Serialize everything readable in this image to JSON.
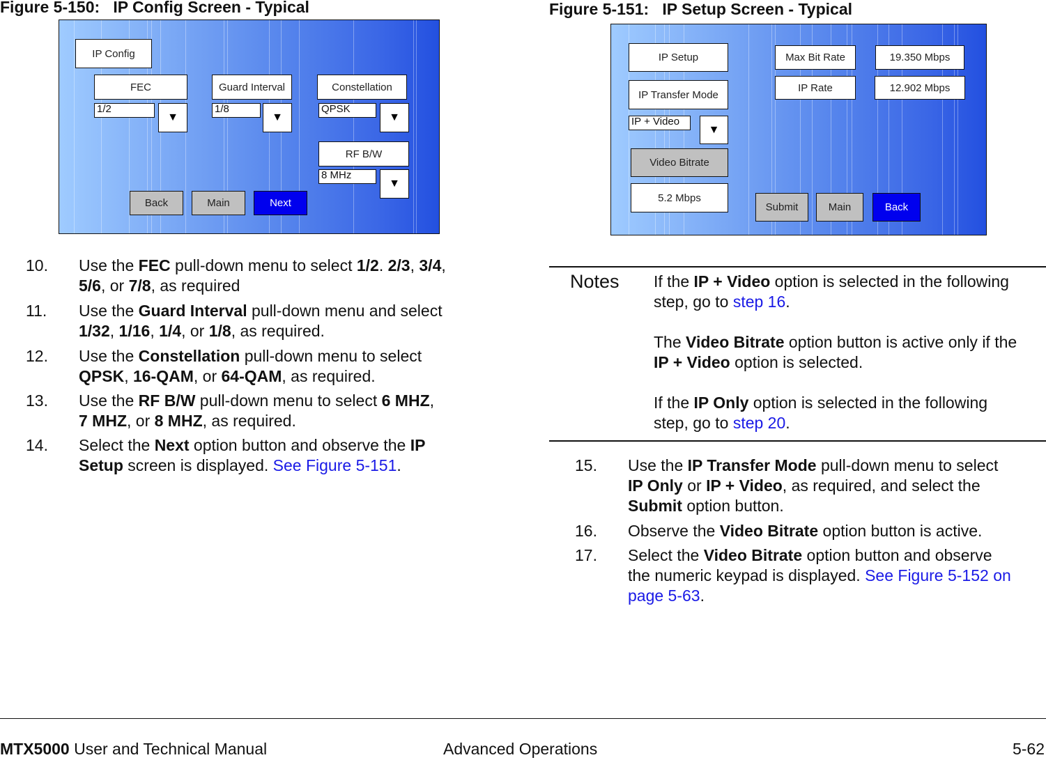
{
  "figure1": {
    "title": "Figure 5-150:   IP Config Screen - Typical",
    "screen_title": "IP Config",
    "fec": {
      "label": "FEC",
      "value": "1/2"
    },
    "guard_interval": {
      "label": "Guard Interval",
      "value": "1/8"
    },
    "constellation": {
      "label": "Constellation",
      "value": "QPSK"
    },
    "rf_bw": {
      "label": "RF B/W",
      "value": "8 MHz"
    },
    "dropdown_glyph": "▼",
    "buttons": {
      "back": "Back",
      "main": "Main",
      "next": "Next"
    }
  },
  "figure2": {
    "title": "Figure 5-151:   IP Setup Screen - Typical",
    "screen_title": "IP Setup",
    "transfer_mode": {
      "label": "IP Transfer Mode",
      "value": "IP + Video"
    },
    "video_bitrate": {
      "label": "Video Bitrate",
      "value": "5.2 Mbps"
    },
    "max_bit_rate": {
      "label": "Max Bit Rate",
      "value": "19.350 Mbps"
    },
    "ip_rate": {
      "label": "IP Rate",
      "value": "12.902 Mbps"
    },
    "dropdown_glyph": "▼",
    "buttons": {
      "submit": "Submit",
      "main": "Main",
      "back": "Back"
    }
  },
  "left_steps": [
    {
      "num": "10.",
      "lines": [
        [
          [
            "t",
            "Use the "
          ],
          [
            "b",
            "FEC"
          ],
          [
            "t",
            " pull-down menu to select "
          ],
          [
            "b",
            "1/2"
          ],
          [
            "t",
            ". "
          ],
          [
            "b",
            "2/3"
          ],
          [
            "t",
            ", "
          ],
          [
            "b",
            "3/4"
          ],
          [
            "t",
            ","
          ]
        ],
        [
          [
            "b",
            "5/6"
          ],
          [
            "t",
            ", or "
          ],
          [
            "b",
            "7/8"
          ],
          [
            "t",
            ", as required"
          ]
        ]
      ]
    },
    {
      "num": "11.",
      "lines": [
        [
          [
            "t",
            "Use the "
          ],
          [
            "b",
            "Guard Interval"
          ],
          [
            "t",
            " pull-down menu and select"
          ]
        ],
        [
          [
            "b",
            "1/32"
          ],
          [
            "t",
            ", "
          ],
          [
            "b",
            "1/16"
          ],
          [
            "t",
            ", "
          ],
          [
            "b",
            "1/4"
          ],
          [
            "t",
            ", or "
          ],
          [
            "b",
            "1/8"
          ],
          [
            "t",
            ", as required."
          ]
        ]
      ]
    },
    {
      "num": "12.",
      "lines": [
        [
          [
            "t",
            "Use the "
          ],
          [
            "b",
            "Constellation"
          ],
          [
            "t",
            " pull-down menu to select"
          ]
        ],
        [
          [
            "b",
            "QPSK"
          ],
          [
            "t",
            ", "
          ],
          [
            "b",
            "16-QAM"
          ],
          [
            "t",
            ", or "
          ],
          [
            "b",
            "64-QAM"
          ],
          [
            "t",
            ", as required."
          ]
        ]
      ]
    },
    {
      "num": "13.",
      "lines": [
        [
          [
            "t",
            " Use the "
          ],
          [
            "b",
            "RF B/W"
          ],
          [
            "t",
            " pull-down menu to select "
          ],
          [
            "b",
            "6 MHZ"
          ],
          [
            "t",
            ","
          ]
        ],
        [
          [
            "b",
            "7 MHZ"
          ],
          [
            "t",
            ", or "
          ],
          [
            "b",
            "8 MHZ"
          ],
          [
            "t",
            ", as required."
          ]
        ]
      ]
    },
    {
      "num": "14.",
      "lines": [
        [
          [
            "t",
            "Select the "
          ],
          [
            "b",
            "Next"
          ],
          [
            "t",
            " option button and observe the "
          ],
          [
            "b",
            "IP"
          ]
        ],
        [
          [
            "b",
            "Setup"
          ],
          [
            "t",
            " screen is displayed.  "
          ],
          [
            "l",
            "See Figure 5-151"
          ],
          [
            "t",
            "."
          ]
        ]
      ]
    }
  ],
  "notes": {
    "label": "Notes",
    "lines": [
      [
        [
          "t",
          "If the "
        ],
        [
          "b",
          "IP + Video"
        ],
        [
          "t",
          " option is selected in the following"
        ]
      ],
      [
        [
          "t",
          "step, go to "
        ],
        [
          "l",
          "step 16"
        ],
        [
          "t",
          "."
        ]
      ],
      [],
      [
        [
          "t",
          "The "
        ],
        [
          "b",
          "Video Bitrate"
        ],
        [
          "t",
          " option button is active only if the"
        ]
      ],
      [
        [
          "b",
          "IP + Video"
        ],
        [
          "t",
          " option is selected."
        ]
      ],
      [],
      [
        [
          "t",
          "If the "
        ],
        [
          "b",
          "IP Only"
        ],
        [
          "t",
          " option is selected in the following"
        ]
      ],
      [
        [
          "t",
          "step, go to "
        ],
        [
          "l",
          "step 20"
        ],
        [
          "t",
          "."
        ]
      ]
    ]
  },
  "right_steps": [
    {
      "num": "15.",
      "lines": [
        [
          [
            "t",
            "Use the "
          ],
          [
            "b",
            "IP Transfer Mode"
          ],
          [
            "t",
            " pull-down menu to select"
          ]
        ],
        [
          [
            "b",
            "IP Only"
          ],
          [
            "t",
            " or "
          ],
          [
            "b",
            "IP + Video"
          ],
          [
            "t",
            ", as required, and select the"
          ]
        ],
        [
          [
            "b",
            "Submit"
          ],
          [
            "t",
            " option button."
          ]
        ]
      ]
    },
    {
      "num": "16.",
      "lines": [
        [
          [
            "t",
            "Observe the "
          ],
          [
            "b",
            "Video Bitrate"
          ],
          [
            "t",
            " option button is active."
          ]
        ]
      ]
    },
    {
      "num": "17.",
      "lines": [
        [
          [
            "t",
            "Select the "
          ],
          [
            "b",
            "Video Bitrate"
          ],
          [
            "t",
            " option button and observe"
          ]
        ],
        [
          [
            "t",
            "the numeric keypad is displayed.  "
          ],
          [
            "l",
            "See Figure 5-152 on"
          ]
        ],
        [
          [
            "l",
            "page 5-63"
          ],
          [
            "t",
            "."
          ]
        ]
      ]
    }
  ],
  "footer": {
    "product": "MTX5000",
    "manual": " User and Technical Manual",
    "section": "Advanced Operations",
    "page": "5-62"
  }
}
